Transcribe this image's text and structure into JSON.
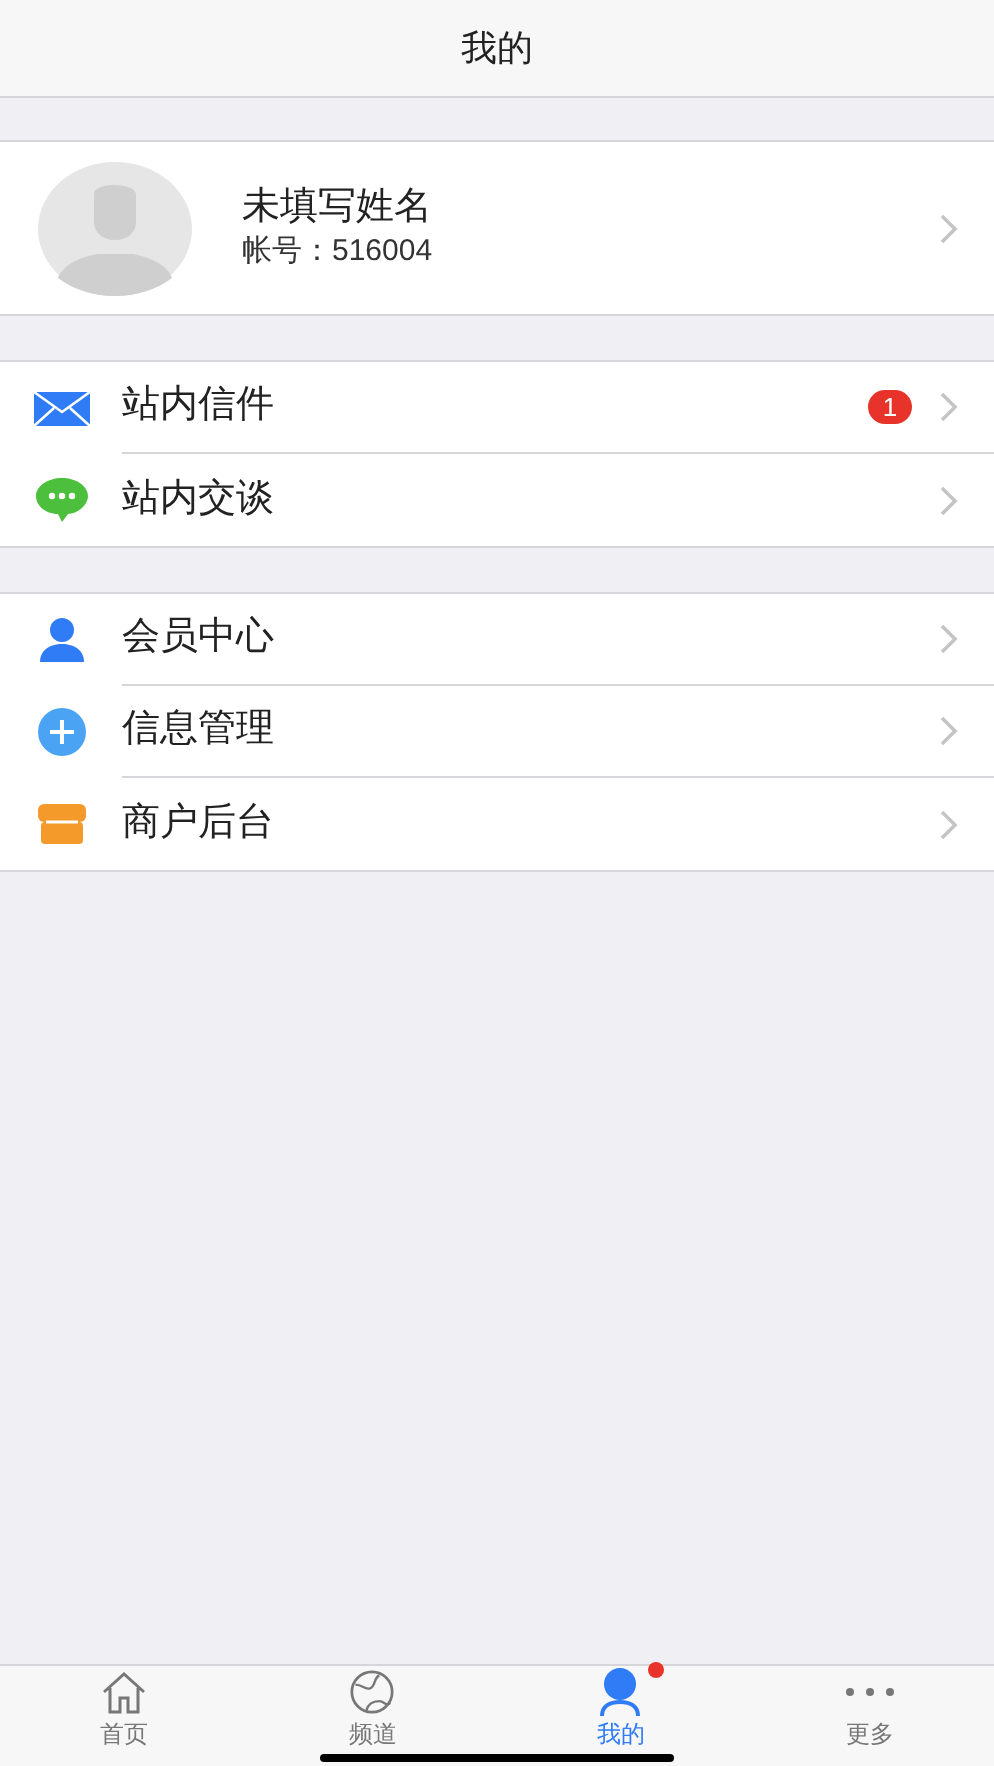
{
  "header": {
    "title": "我的"
  },
  "profile": {
    "name": "未填写姓名",
    "account": "帐号：516004"
  },
  "groups": [
    [
      {
        "kind": "mail",
        "label": "站内信件",
        "badge": "1"
      },
      {
        "kind": "chat",
        "label": "站内交谈"
      }
    ],
    [
      {
        "kind": "user",
        "label": "会员中心"
      },
      {
        "kind": "plus",
        "label": "信息管理"
      },
      {
        "kind": "shop",
        "label": "商户后台"
      }
    ]
  ],
  "tabs": [
    {
      "kind": "home",
      "label": "首页",
      "selected": false,
      "dot": false
    },
    {
      "kind": "globe",
      "label": "频道",
      "selected": false,
      "dot": false
    },
    {
      "kind": "person",
      "label": "我的",
      "selected": true,
      "dot": true
    },
    {
      "kind": "more",
      "label": "更多",
      "selected": false,
      "dot": false
    }
  ]
}
